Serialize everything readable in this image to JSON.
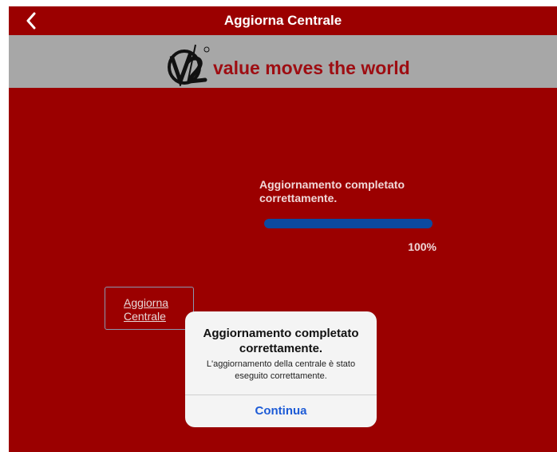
{
  "navbar": {
    "title": "Aggiorna Centrale",
    "back_icon": "chevron-left-icon"
  },
  "brand": {
    "logo_icon": "v2-logo-icon",
    "slogan": "value moves the world",
    "slogan_color": "#9e0d12"
  },
  "status": {
    "message": "Aggiornamento completato correttamente.",
    "progress_fraction": 1.0,
    "progress_label": "100%",
    "progress_color": "#0c4aa0"
  },
  "update_button": {
    "label_line1": "Aggiorna",
    "label_line2": "Centrale"
  },
  "alert": {
    "title": "Aggiornamento completato correttamente.",
    "message": "L'aggiornamento della centrale è stato eseguito correttamente.",
    "action_label": "Continua"
  },
  "colors": {
    "background": "#9b0000",
    "brand_bar": "#a7a7a7"
  }
}
